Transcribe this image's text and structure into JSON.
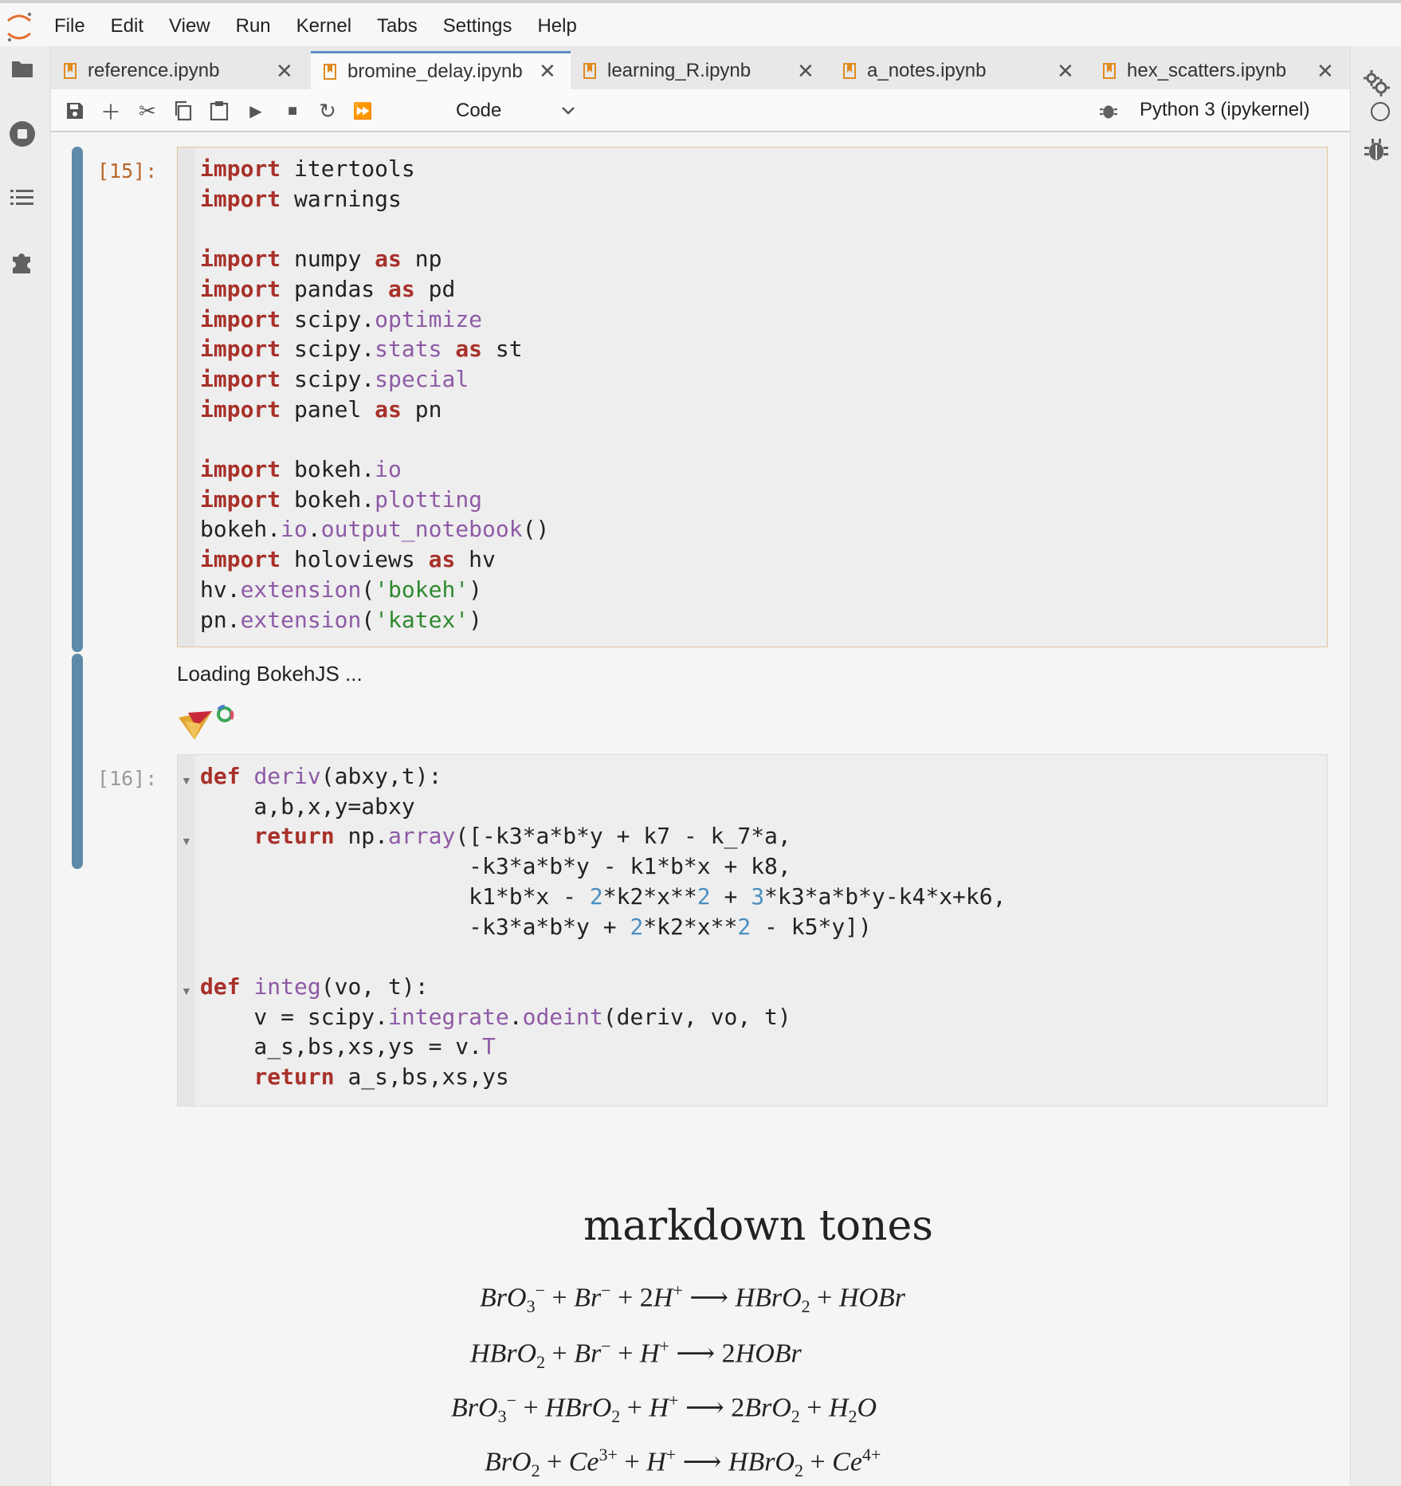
{
  "menu": [
    "File",
    "Edit",
    "View",
    "Run",
    "Kernel",
    "Tabs",
    "Settings",
    "Help"
  ],
  "tabs": [
    {
      "label": "reference.ipynb",
      "active": false
    },
    {
      "label": "bromine_delay.ipynb",
      "active": true
    },
    {
      "label": "learning_R.ipynb",
      "active": false
    },
    {
      "label": "a_notes.ipynb",
      "active": false
    },
    {
      "label": "hex_scatters.ipynb",
      "active": false
    }
  ],
  "toolbar": {
    "cell_type": "Code",
    "kernel": "Python 3 (ipykernel)"
  },
  "cells": {
    "c15": {
      "prompt": "[15]:",
      "output": "Loading BokehJS ..."
    },
    "c16": {
      "prompt": "[16]:"
    }
  },
  "markdown": {
    "title": "markdown tones"
  },
  "colors": {
    "accent": "#5b8fc6",
    "collapser": "#5d8aa8",
    "keyword": "#a8312a",
    "attribute": "#8e5aa6",
    "string": "#2f8a2f",
    "number": "#4a8fc0",
    "notebook_icon": "#e08a1e"
  },
  "icons": {
    "left_sidebar": [
      "folder-icon",
      "running-stop-icon",
      "table-of-contents-icon",
      "extension-puzzle-icon"
    ],
    "right_sidebar": [
      "property-inspector-gears-icon",
      "debugger-bug-icon"
    ],
    "toolbar": [
      "save-icon",
      "add-cell-icon",
      "cut-icon",
      "copy-icon",
      "paste-icon",
      "run-icon",
      "stop-icon",
      "restart-icon",
      "fast-forward-icon",
      "chevron-down-icon",
      "bug-icon",
      "kernel-status-icon"
    ]
  }
}
